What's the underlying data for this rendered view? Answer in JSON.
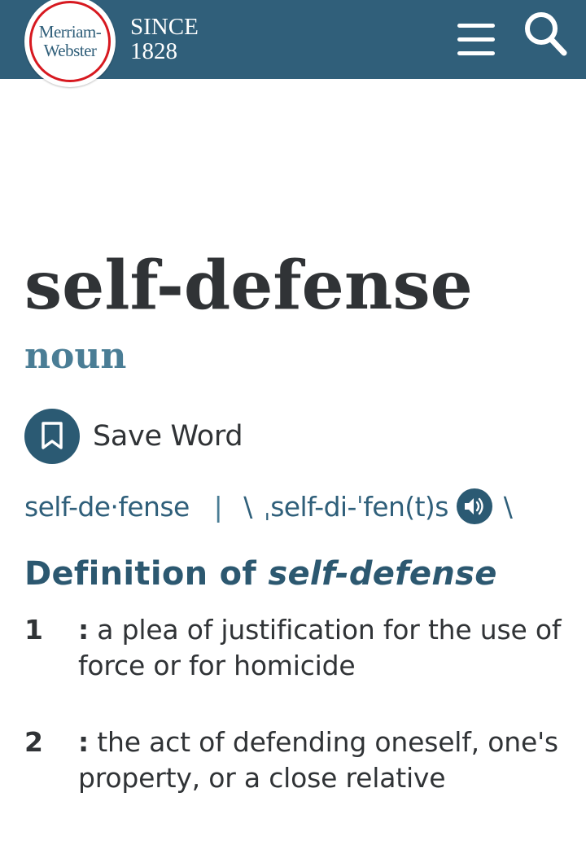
{
  "header": {
    "logo_line1": "Merriam-",
    "logo_line2": "Webster",
    "since_line1": "SINCE",
    "since_line2": "1828",
    "menu_icon": "hamburger-menu-icon",
    "search_icon": "search-icon",
    "background_color": "#305f7a",
    "logo_ring_color": "#d71920"
  },
  "entry": {
    "headword": "self-defense",
    "part_of_speech": "noun",
    "save_label": "Save Word",
    "save_icon": "bookmark-icon",
    "syllables": "self-de·fense",
    "separator": "|",
    "pron_open": "\\",
    "pronunciation": "ˌself-di-ˈfen(t)s",
    "pron_close": "\\",
    "audio_icon": "speaker-audio-icon"
  },
  "definitions": {
    "heading_prefix": "Definition of",
    "heading_word": "self-defense",
    "senses": [
      {
        "number": "1",
        "colon": ":",
        "text": "a plea of justification for the use of force or for homicide"
      },
      {
        "number": "2",
        "colon": ":",
        "text": "the act of defending oneself, one's property, or a close relative"
      }
    ]
  }
}
